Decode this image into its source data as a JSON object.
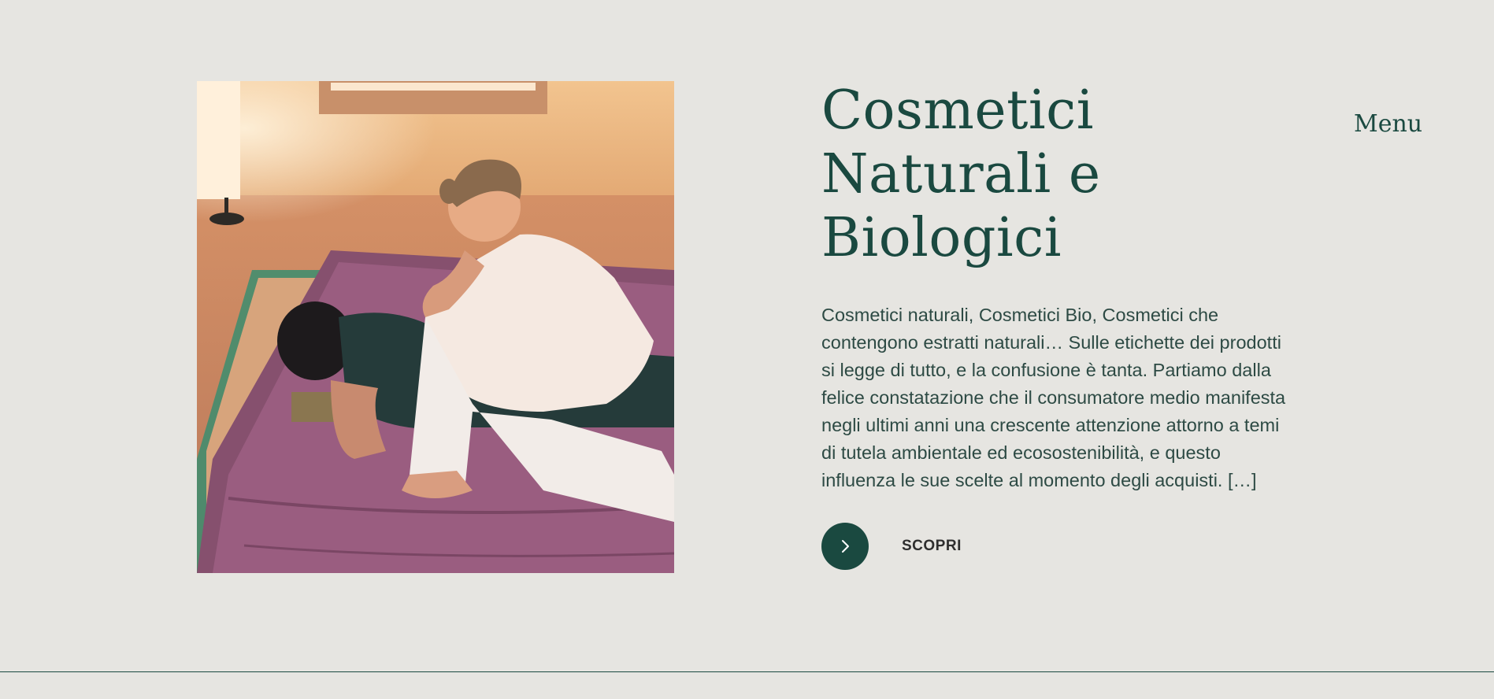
{
  "hero": {
    "title_lines": [
      "Cosmetici",
      "Naturali e",
      "Biologici"
    ],
    "description": "Cosmetici naturali, Cosmetici Bio, Cosmetici che contengono estratti naturali… Sulle etichette dei prodotti si legge di tutto, e la confusione è tanta. Partiamo dalla felice constatazione che il consumatore medio manifesta negli ultimi anni una crescente attenzione attorno a temi di tutela ambientale ed ecosostenibilità, e questo influenza le sue scelte al momento degli acquisti. […]",
    "cta_label": "SCOPRI",
    "cta_icon": "chevron-right-icon"
  },
  "nav": {
    "menu_label": "Menu"
  },
  "colors": {
    "background": "#e6e5e1",
    "accent": "#1a4940"
  }
}
